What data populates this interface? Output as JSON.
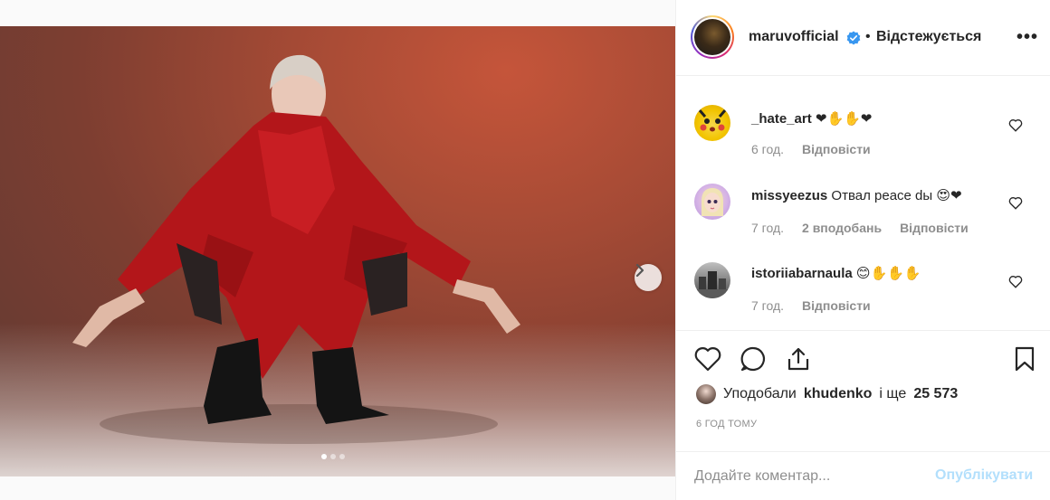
{
  "post": {
    "photo_alt": "",
    "carousel": {
      "count": 3,
      "active": 1
    }
  },
  "header": {
    "username": "maruvofficial",
    "separator": "•",
    "follow_status": "Відстежується",
    "more_icon": "more-icon"
  },
  "comments": [
    {
      "user": "_hate_art",
      "text": "",
      "emoji": "❤✋✋❤",
      "time": "6 год.",
      "likes": "",
      "reply": "Відповісти"
    },
    {
      "user": "missyeezus",
      "text": "Отвал peace dы",
      "emoji": "😍❤",
      "time": "7 год.",
      "likes": "2 вподобань",
      "reply": "Відповісти"
    },
    {
      "user": "istoriiabarnaula",
      "text": "",
      "emoji": "😊✋✋✋",
      "time": "7 год.",
      "likes": "",
      "reply": "Відповісти"
    }
  ],
  "likes": {
    "prefix": "Уподобали",
    "user": "khudenko",
    "middle": "і ще",
    "count": "25 573"
  },
  "time_ago": "6 ГОД ТОМУ",
  "add_comment": {
    "placeholder": "Додайте коментар...",
    "publish": "Опублікувати"
  },
  "colors": {
    "accent_disabled": "#b2dffc",
    "verified": "#3897f0",
    "heart": "#ed4956"
  }
}
